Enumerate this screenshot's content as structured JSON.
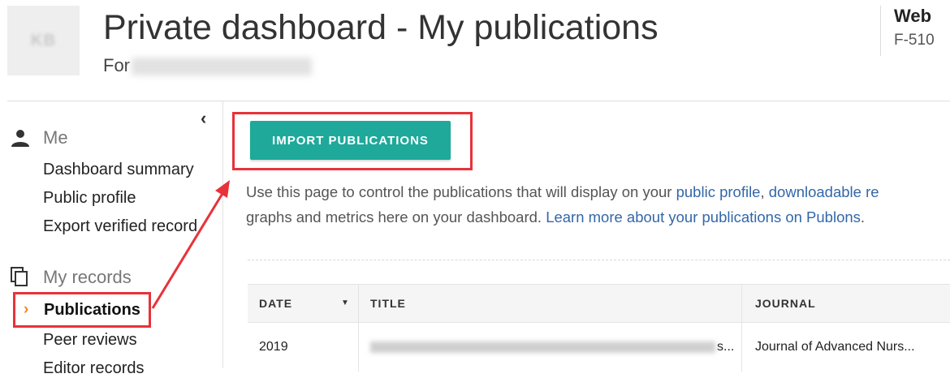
{
  "header": {
    "avatar_initials": "KB",
    "title": "Private dashboard - My publications",
    "for_label": "For",
    "right_title": "Web",
    "right_sub": "F-510"
  },
  "sidebar": {
    "collapse_icon": "‹",
    "section_me": "Me",
    "links_me": [
      "Dashboard summary",
      "Public profile",
      "Export verified record"
    ],
    "section_records": "My records",
    "active_item": "Publications",
    "links_records": [
      "Peer reviews",
      "Editor records"
    ]
  },
  "main": {
    "import_button": "IMPORT PUBLICATIONS",
    "description_line1_prefix": "Use this page to control the publications that will display on your ",
    "description_link1": "public profile",
    "description_line1_mid": ", ",
    "description_link2": "downloadable re",
    "description_line2_prefix": "graphs and metrics here on your dashboard. ",
    "description_link3": "Learn more about your publications on Publons",
    "description_line2_suffix": "."
  },
  "table": {
    "columns": [
      "DATE",
      "TITLE",
      "JOURNAL"
    ],
    "rows": [
      {
        "date": "2019",
        "title_suffix": "s...",
        "journal": "Journal of Advanced Nurs..."
      }
    ]
  },
  "colors": {
    "accent": "#1ea99a",
    "annotation": "#e8323a",
    "link": "#3367a8",
    "active_chevron": "#f08a24"
  }
}
